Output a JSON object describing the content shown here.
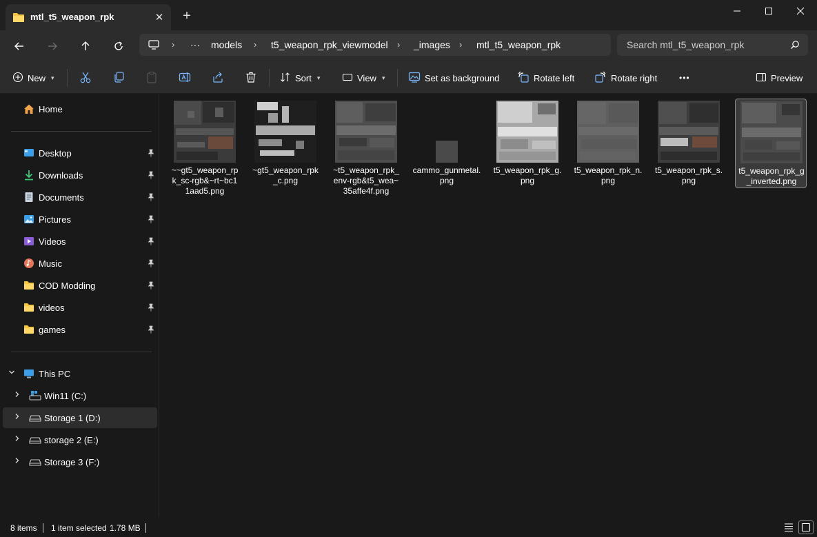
{
  "window": {
    "tab_title": "mtl_t5_weapon_rpk",
    "tab_close": "✕",
    "new_tab": "+"
  },
  "nav": {
    "more_crumbs": "···",
    "breadcrumbs": [
      "models",
      "t5_weapon_rpk_viewmodel",
      "_images",
      "mtl_t5_weapon_rpk"
    ],
    "separator": "›",
    "search_placeholder": "Search mtl_t5_weapon_rpk"
  },
  "commands": {
    "new": "New",
    "sort": "Sort",
    "view": "View",
    "set_background": "Set as background",
    "rotate_left": "Rotate left",
    "rotate_right": "Rotate right",
    "more": "•••",
    "preview": "Preview"
  },
  "sidebar": {
    "home": "Home",
    "quick_access": [
      {
        "label": "Desktop",
        "icon": "desktop-icon"
      },
      {
        "label": "Downloads",
        "icon": "downloads-icon"
      },
      {
        "label": "Documents",
        "icon": "documents-icon"
      },
      {
        "label": "Pictures",
        "icon": "pictures-icon"
      },
      {
        "label": "Videos",
        "icon": "videos-icon"
      },
      {
        "label": "Music",
        "icon": "music-icon"
      },
      {
        "label": "COD Modding",
        "icon": "folder-icon"
      },
      {
        "label": "videos",
        "icon": "folder-icon"
      },
      {
        "label": "games",
        "icon": "folder-icon"
      }
    ],
    "this_pc": "This PC",
    "drives": [
      {
        "label": "Win11 (C:)",
        "icon": "windows-drive-icon"
      },
      {
        "label": "Storage 1 (D:)",
        "icon": "drive-icon"
      },
      {
        "label": "storage 2 (E:)",
        "icon": "drive-icon"
      },
      {
        "label": "Storage 3 (F:)",
        "icon": "drive-icon"
      }
    ]
  },
  "files": [
    {
      "name": "~~gt5_weapon_rpk_sc-rgb&~rt~bc11aad5.png"
    },
    {
      "name": "~gt5_weapon_rpk_c.png"
    },
    {
      "name": "~t5_weapon_rpk_env-rgb&t5_wea~35affe4f.png"
    },
    {
      "name": "cammo_gunmetal.png"
    },
    {
      "name": "t5_weapon_rpk_g.png"
    },
    {
      "name": "t5_weapon_rpk_n.png"
    },
    {
      "name": "t5_weapon_rpk_s.png"
    },
    {
      "name": "t5_weapon_rpk_g_inverted.png"
    }
  ],
  "status": {
    "items": "8 items",
    "selected": "1 item selected",
    "size": "1.78 MB"
  },
  "colors": {
    "folder": "#f4c542",
    "accent": "#4cc2ff"
  }
}
